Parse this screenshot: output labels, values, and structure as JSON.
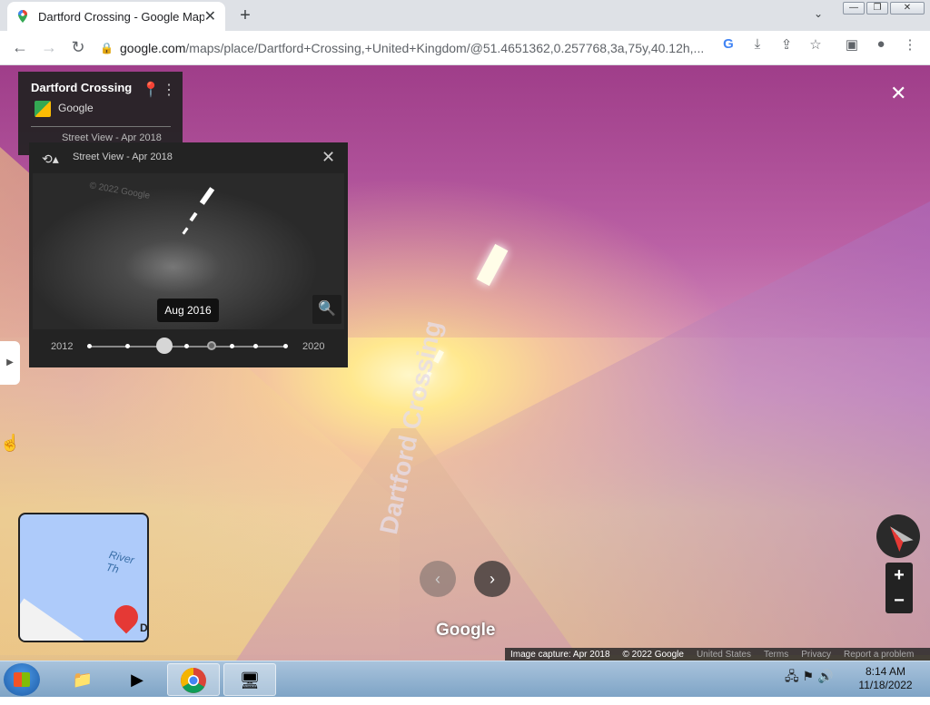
{
  "browser": {
    "tab_title": "Dartford Crossing - Google Maps",
    "tab_close": "✕",
    "new_tab": "+",
    "tab_search": "⌄",
    "url_domain": "google.com",
    "url_rest": "/maps/place/Dartford+Crossing,+United+Kingdom/@51.4651362,0.257768,3a,75y,40.12h,...",
    "window_controls": {
      "minimize": "—",
      "restore": "❐",
      "close": "✕"
    }
  },
  "streetview": {
    "info_card": {
      "title": "Dartford Crossing",
      "owner": "Google",
      "street_view_date": "Street View - Apr 2018"
    },
    "time_travel": {
      "header": "Street View - Apr 2018",
      "tooltip": "Aug 2016",
      "start_year": "2012",
      "end_year": "2020",
      "thumbnail_watermark": "© 2022 Google"
    },
    "road_text": "Dartford Crossing",
    "minimap": {
      "river_label": "River Th",
      "pin_label": "D"
    },
    "google_logo": "Google",
    "footer": {
      "capture": "Image capture: Apr 2018",
      "copyright": "© 2022 Google",
      "country": "United States",
      "terms": "Terms",
      "privacy": "Privacy",
      "report": "Report a problem"
    },
    "zoom": {
      "in": "+",
      "out": "−"
    }
  },
  "taskbar": {
    "clock_time": "8:14 AM",
    "clock_date": "11/18/2022"
  }
}
